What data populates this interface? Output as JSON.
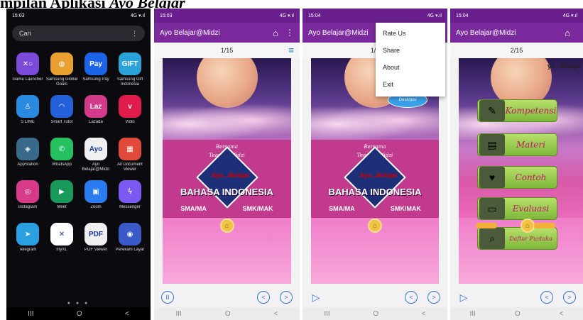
{
  "caption": {
    "prefix": "mpilan Aplikasi ",
    "app_name": "Ayo Belajar"
  },
  "launcher": {
    "time": "15:03",
    "signal": "4G ▾.ıl",
    "search_placeholder": "Cari",
    "menu_glyph": "⋮",
    "apps": [
      {
        "label": "Game Launcher",
        "icon": "game-launcher-icon",
        "glyph": "✕○",
        "color": "#7b4ad8"
      },
      {
        "label": "Samsung Global Goals",
        "icon": "global-goals-icon",
        "glyph": "◍",
        "color": "#e8a030"
      },
      {
        "label": "Samsung Pay",
        "icon": "samsung-pay-icon",
        "glyph": "Pay",
        "color": "#1b64e8"
      },
      {
        "label": "Samsung Gift Indonesia",
        "icon": "gift-icon",
        "glyph": "GIFT",
        "color": "#2aa3d8"
      },
      {
        "label": "S LIME",
        "icon": "s-lime-icon",
        "glyph": "♙",
        "color": "#2a8ae0"
      },
      {
        "label": "Smart Tutor",
        "icon": "headset-icon",
        "glyph": "◠",
        "color": "#2460d8"
      },
      {
        "label": "Lazada",
        "icon": "lazada-icon",
        "glyph": "Laz",
        "color": "#d43a8a"
      },
      {
        "label": "Vidio",
        "icon": "vidio-icon",
        "glyph": "v",
        "color": "#e01a4a"
      },
      {
        "label": "AppStation",
        "icon": "appstation-icon",
        "glyph": "◈",
        "color": "#3a6a8a"
      },
      {
        "label": "WhatsApp",
        "icon": "whatsapp-icon",
        "glyph": "✆",
        "color": "#25c060"
      },
      {
        "label": "Ayo Belajar@Midzi",
        "icon": "ayo-belajar-icon",
        "glyph": "Ayo",
        "color": "#f0f0f0"
      },
      {
        "label": "All Document Viewer",
        "icon": "document-viewer-icon",
        "glyph": "▦",
        "color": "#e04a3a"
      },
      {
        "label": "Instagram",
        "icon": "instagram-icon",
        "glyph": "◎",
        "color": "#d83a8a"
      },
      {
        "label": "Meet",
        "icon": "meet-icon",
        "glyph": "▶",
        "color": "#1a9a5a"
      },
      {
        "label": "Zoom",
        "icon": "zoom-icon",
        "glyph": "▣",
        "color": "#2a7af0"
      },
      {
        "label": "Messenger",
        "icon": "messenger-icon",
        "glyph": "ϟ",
        "color": "#7a5af0"
      },
      {
        "label": "Telegram",
        "icon": "telegram-icon",
        "glyph": "➤",
        "color": "#2aa0e0"
      },
      {
        "label": "myXL",
        "icon": "myxl-icon",
        "glyph": "✕",
        "color": "#ffffff"
      },
      {
        "label": "PDF Viewer",
        "icon": "pdf-viewer-icon",
        "glyph": "PDF",
        "color": "#f0f0f0"
      },
      {
        "label": "Perekam Layar",
        "icon": "screen-recorder-icon",
        "glyph": "◉",
        "color": "#3a5ac8"
      }
    ],
    "page_dots": "● ● ●",
    "nav": {
      "recents": "III",
      "home": "O",
      "back": "<"
    }
  },
  "app": {
    "title": "Ayo Belajar@Midzi",
    "home_glyph": "⌂",
    "kebab_glyph": "⋮",
    "hamburger_glyph": "≡",
    "signal": "4G ▾.ıl"
  },
  "screen2": {
    "time": "15:03",
    "page": "1/15"
  },
  "screen3": {
    "time": "15:04",
    "page": "1/15",
    "page_visible": "1/1",
    "bubble": "Deskripsi"
  },
  "screen4": {
    "time": "15:04",
    "page": "2/15"
  },
  "cover": {
    "credit_line1": "Bersama",
    "credit_line2": "Teacher Midzi",
    "logo": "Ayo...Belajar",
    "subject": "BAHASA INDONESIA",
    "level_left": "SMA/MA",
    "level_right": "SMK/MAK",
    "home_glyph": "⌂"
  },
  "overflow_menu": [
    "Rate Us",
    "Share",
    "About",
    "Exit"
  ],
  "menu_page": {
    "logo": "yo...Belajar",
    "items": [
      {
        "label": "Kompetensi",
        "icon": "pencil-icon",
        "glyph": "✎"
      },
      {
        "label": "Materi",
        "icon": "document-icon",
        "glyph": "▤"
      },
      {
        "label": "Contoh",
        "icon": "heart-icon",
        "glyph": "♥"
      },
      {
        "label": "Evaluasi",
        "icon": "notepad-icon",
        "glyph": "▭"
      },
      {
        "label": "Daftar Pustaka",
        "icon": "magnifier-icon",
        "glyph": "⌕"
      }
    ]
  },
  "controls": {
    "pause": "II",
    "play": "▷",
    "prev": "<",
    "next": ">"
  },
  "nav": {
    "recents": "III",
    "home": "O",
    "back": "<"
  }
}
